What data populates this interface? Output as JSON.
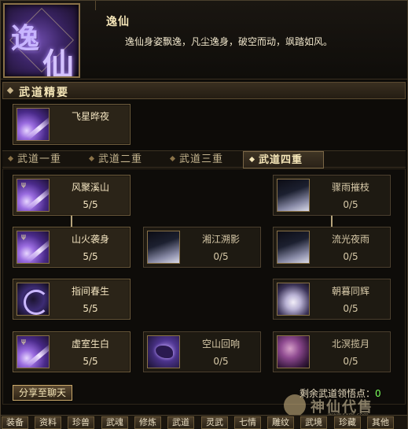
{
  "header": {
    "emblem_chars": [
      "逸",
      "仙"
    ],
    "title": "逸仙",
    "description": "逸仙身姿飘逸，凡尘逸身，破空而动，飒踏如风。"
  },
  "essentials": {
    "section_label": "武道精要",
    "skill": {
      "name": "飞星晔夜",
      "icon": "purple-shooting-star-icon"
    }
  },
  "tabs": [
    {
      "label": "武道一重",
      "active": false
    },
    {
      "label": "武道二重",
      "active": false
    },
    {
      "label": "武道三重",
      "active": false
    },
    {
      "label": "武道四重",
      "active": true
    }
  ],
  "skills": [
    {
      "name": "风聚溪山",
      "level": "5/5",
      "icon": "purple-streak-icon",
      "unlocked": true
    },
    {
      "name": "骤雨摧枝",
      "level": "0/5",
      "icon": "mist-icon",
      "unlocked": false
    },
    {
      "name": "山火袭身",
      "level": "5/5",
      "icon": "purple-streak-icon",
      "unlocked": true
    },
    {
      "name": "湘江溯影",
      "level": "0/5",
      "icon": "mist-icon",
      "unlocked": false
    },
    {
      "name": "流光夜雨",
      "level": "0/5",
      "icon": "mist-icon",
      "unlocked": false
    },
    {
      "name": "指间春生",
      "level": "5/5",
      "icon": "crescent-ring-icon",
      "unlocked": true
    },
    {
      "name": "朝暮同辉",
      "level": "0/5",
      "icon": "white-bloom-icon",
      "unlocked": false
    },
    {
      "name": "虚室生白",
      "level": "5/5",
      "icon": "purple-streak-icon",
      "unlocked": true
    },
    {
      "name": "空山回响",
      "level": "0/5",
      "icon": "violet-comet-icon",
      "unlocked": false
    },
    {
      "name": "北溟揽月",
      "level": "0/5",
      "icon": "rose-moon-icon",
      "unlocked": false
    }
  ],
  "footer": {
    "share_label": "分享至聊天",
    "points_label": "剩余武道领悟点：",
    "points_value": "0",
    "watermark_text": "神仙代售",
    "watermark_url": "www.sxds.com"
  },
  "bottom_tabs": [
    "装备",
    "资料",
    "珍兽",
    "武魂",
    "修炼",
    "武道",
    "灵武",
    "七情",
    "雕纹",
    "武境",
    "珍藏",
    "其他"
  ],
  "colors": {
    "accent": "#f5e6b8",
    "border": "#6e5c3c",
    "points": "#7aff5a"
  }
}
